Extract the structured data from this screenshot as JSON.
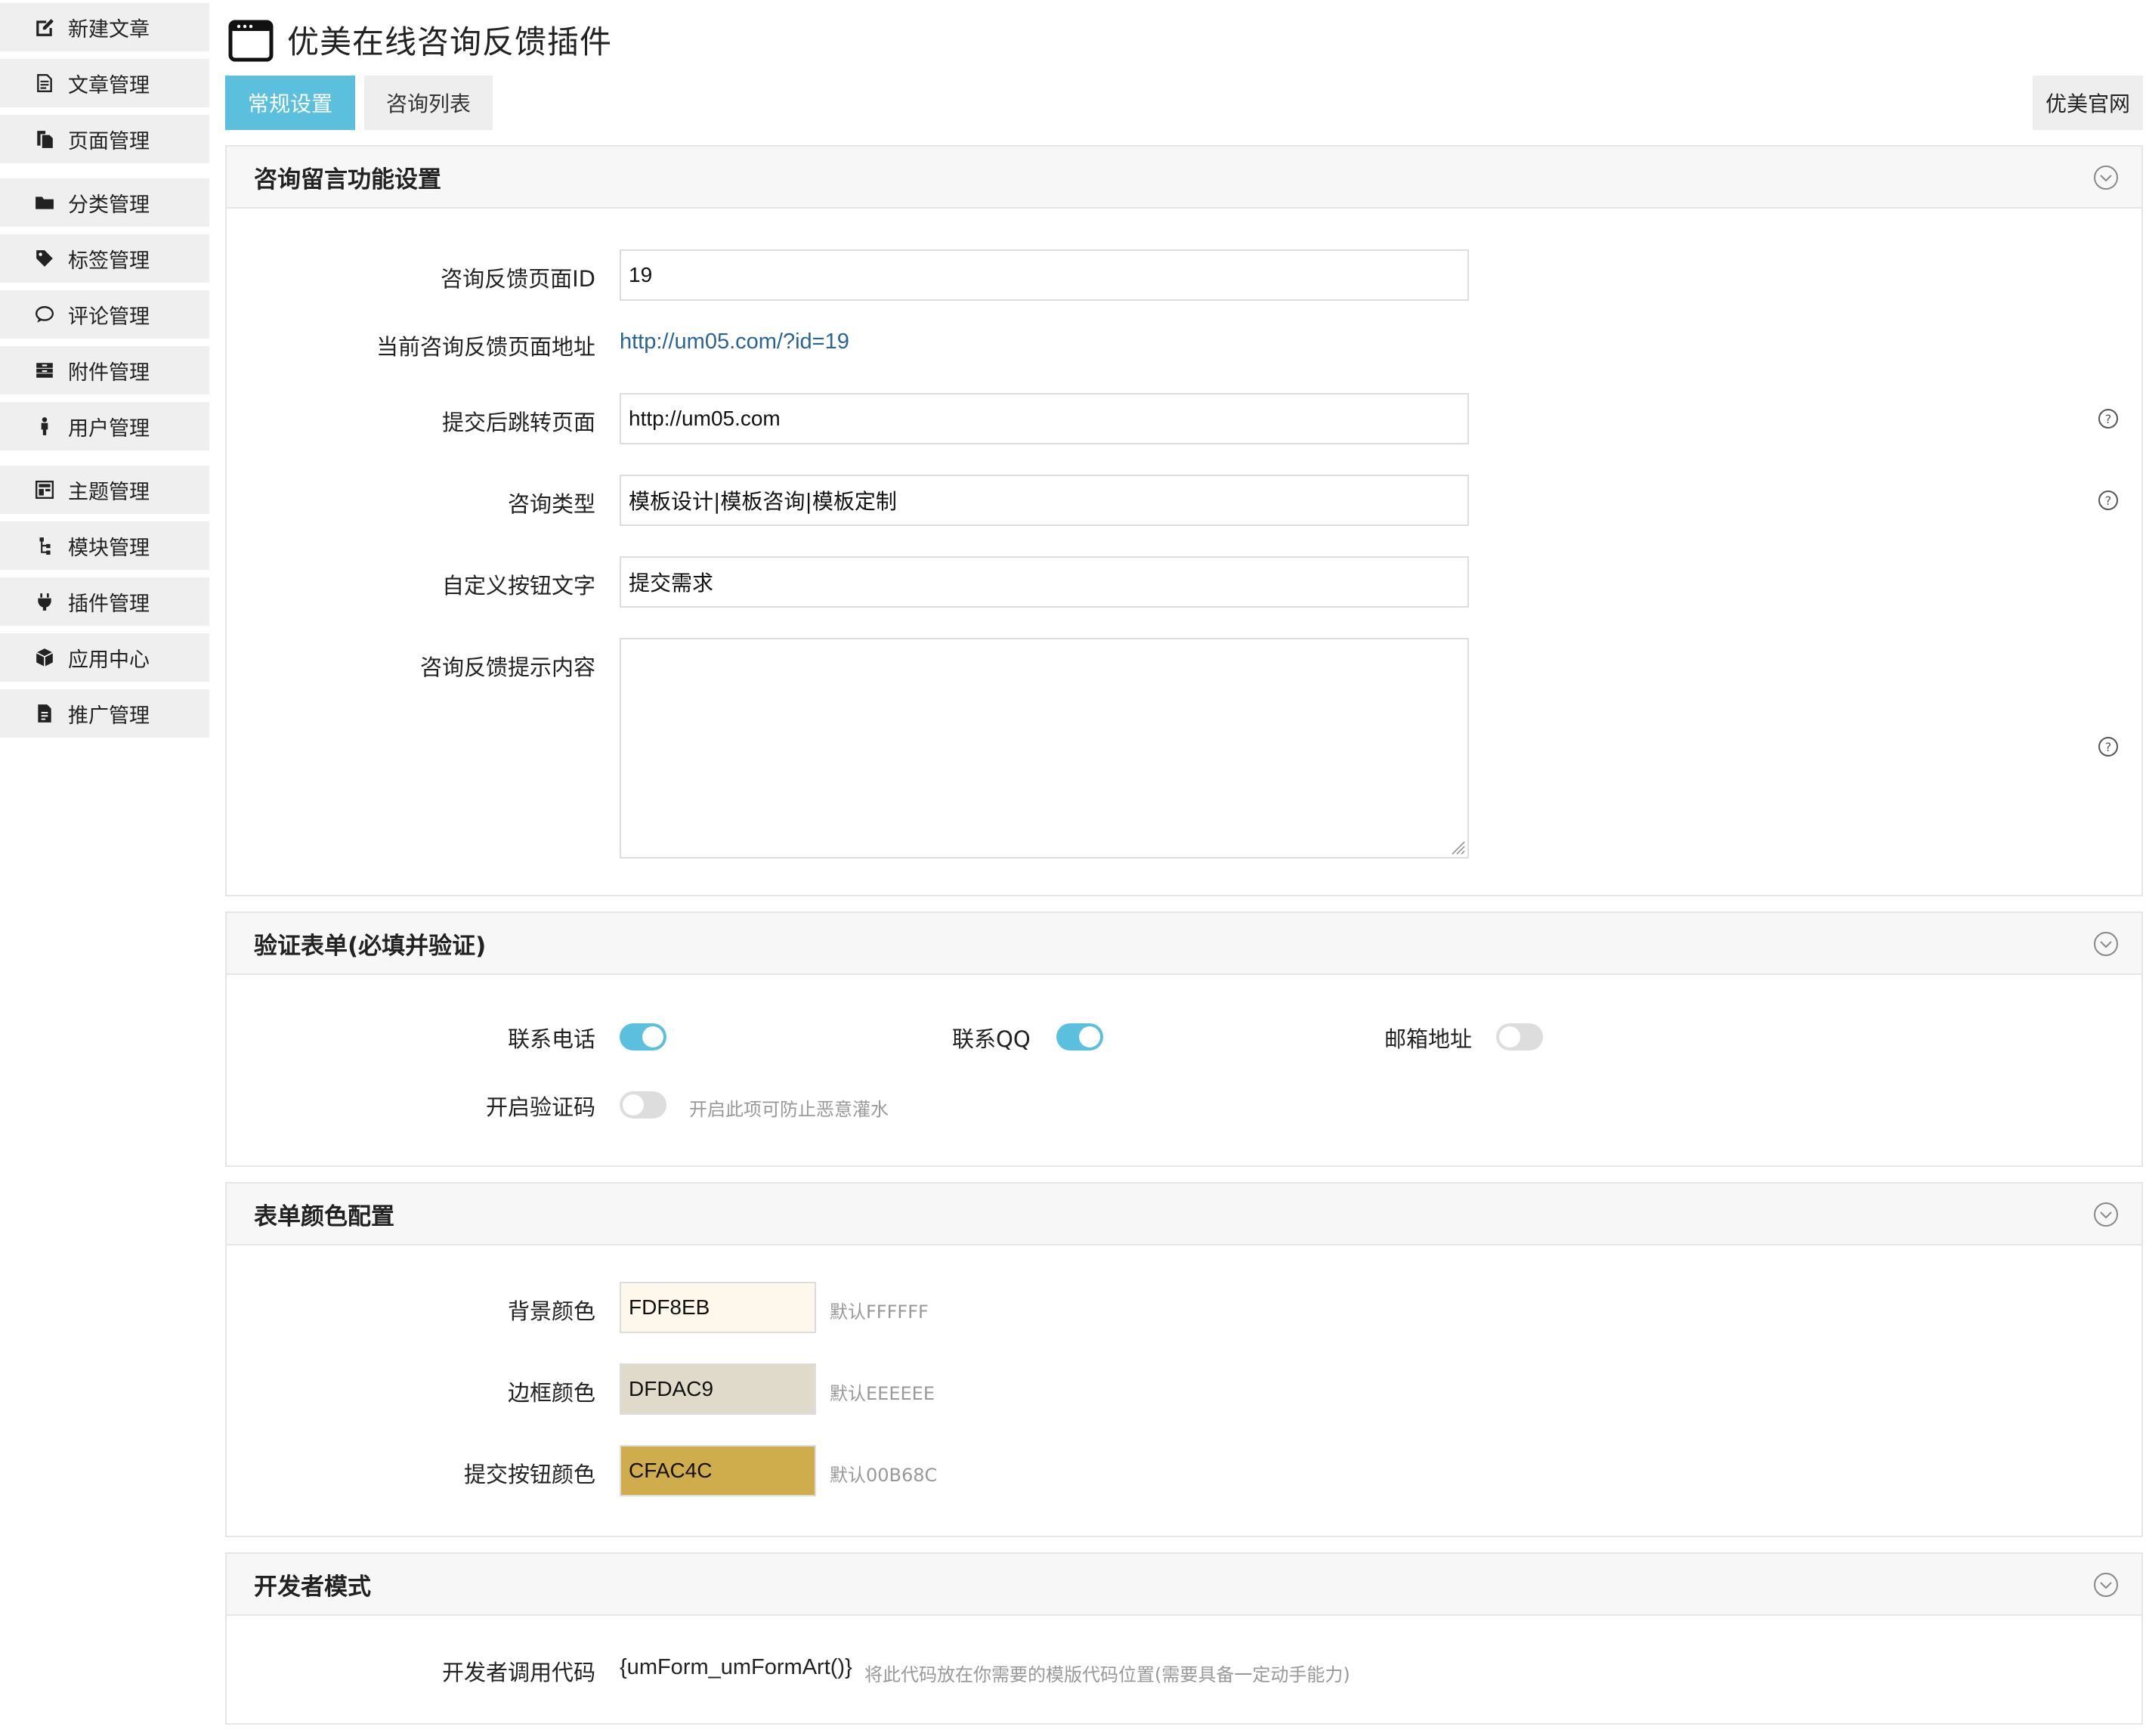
{
  "sidebar": {
    "items": [
      {
        "label": "新建文章",
        "icon": "edit-icon"
      },
      {
        "label": "文章管理",
        "icon": "file-list-icon"
      },
      {
        "label": "页面管理",
        "icon": "page-copy-icon"
      },
      {
        "label": "分类管理",
        "icon": "folder-icon"
      },
      {
        "label": "标签管理",
        "icon": "tag-icon"
      },
      {
        "label": "评论管理",
        "icon": "comment-icon"
      },
      {
        "label": "附件管理",
        "icon": "archive-icon"
      },
      {
        "label": "用户管理",
        "icon": "user-icon"
      },
      {
        "label": "主题管理",
        "icon": "theme-layout-icon"
      },
      {
        "label": "模块管理",
        "icon": "sitemap-icon"
      },
      {
        "label": "插件管理",
        "icon": "plug-icon"
      },
      {
        "label": "应用中心",
        "icon": "cube-icon"
      },
      {
        "label": "推广管理",
        "icon": "document-icon"
      }
    ]
  },
  "header": {
    "title": "优美在线咨询反馈插件",
    "tabs": [
      {
        "label": "常规设置",
        "active": true
      },
      {
        "label": "咨询列表",
        "active": false
      }
    ],
    "site_button": "优美官网"
  },
  "colors": {
    "accent": "#5bc0de",
    "link": "#2a6496"
  },
  "panel_feedback": {
    "title": "咨询留言功能设置",
    "page_id_label": "咨询反馈页面ID",
    "page_id_value": "19",
    "page_url_label": "当前咨询反馈页面地址",
    "page_url_value": "http://um05.com/?id=19",
    "redirect_label": "提交后跳转页面",
    "redirect_value": "http://um05.com",
    "types_label": "咨询类型",
    "types_value": "模板设计|模板咨询|模板定制",
    "button_text_label": "自定义按钮文字",
    "button_text_value": "提交需求",
    "tip_label": "咨询反馈提示内容",
    "tip_value": ""
  },
  "panel_validation": {
    "title": "验证表单(必填并验证)",
    "phone_label": "联系电话",
    "phone_on": true,
    "qq_label": "联系QQ",
    "qq_on": true,
    "email_label": "邮箱地址",
    "email_on": false,
    "captcha_label": "开启验证码",
    "captcha_on": false,
    "captcha_hint": "开启此项可防止恶意灌水"
  },
  "panel_colors": {
    "title": "表单颜色配置",
    "bg_label": "背景颜色",
    "bg_value": "FDF8EB",
    "bg_default": "默认FFFFFF",
    "border_label": "边框颜色",
    "border_value": "DFDAC9",
    "border_default": "默认EEEEEE",
    "submit_label": "提交按钮颜色",
    "submit_value": "CFAC4C",
    "submit_default": "默认00B68C"
  },
  "panel_dev": {
    "title": "开发者模式",
    "code_label": "开发者调用代码",
    "code_value": "{umForm_umFormArt()}",
    "code_hint": "将此代码放在你需要的模版代码位置(需要具备一定动手能力)"
  }
}
